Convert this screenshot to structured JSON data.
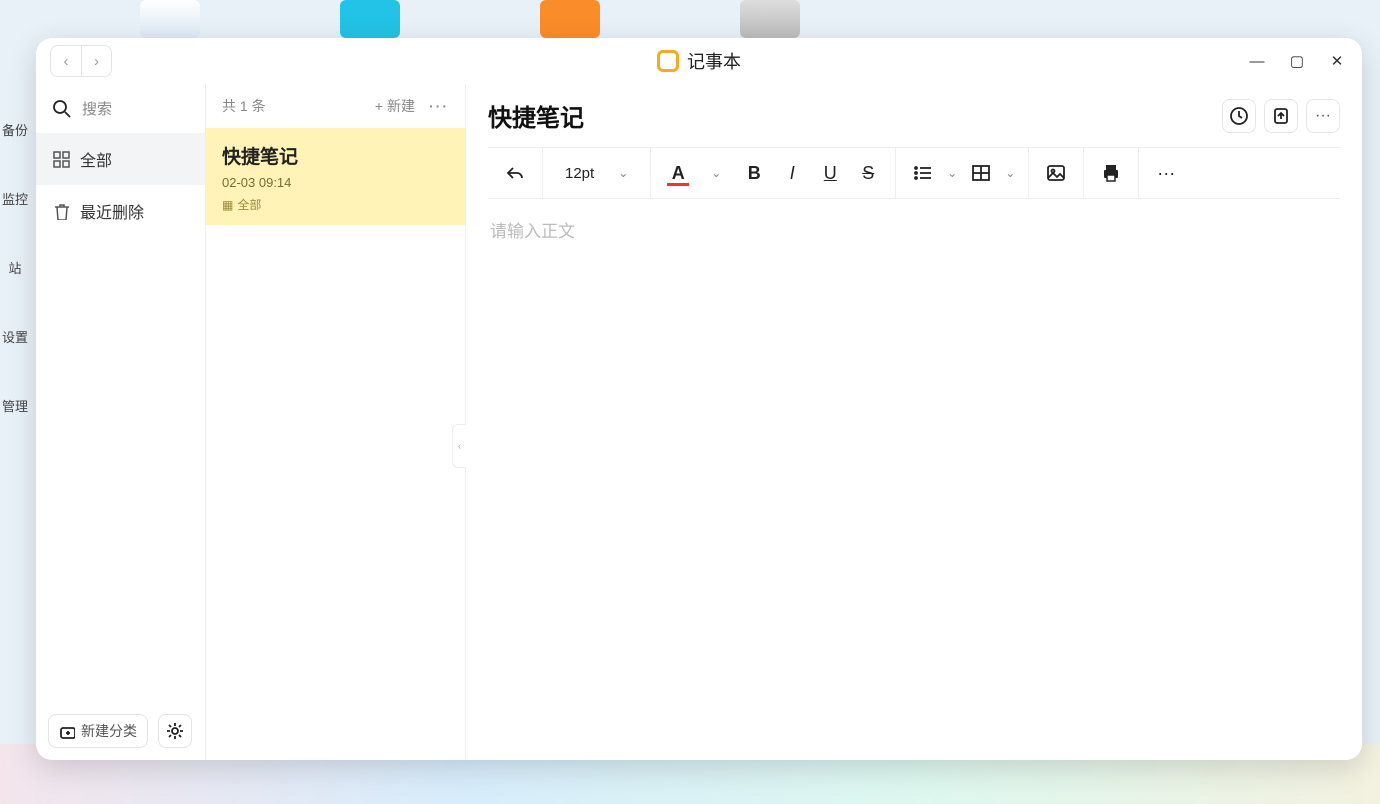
{
  "window": {
    "app_title": "记事本"
  },
  "dock": {
    "l1": "备份",
    "l2": "监控",
    "l3": "站",
    "l4": "设置",
    "l5": "管理"
  },
  "sidebar": {
    "search_placeholder": "搜索",
    "items": [
      {
        "label": "全部"
      },
      {
        "label": "最近删除"
      }
    ],
    "new_category": "新建分类"
  },
  "list": {
    "count_label": "共 1 条",
    "new_label": "新建",
    "notes": [
      {
        "title": "快捷笔记",
        "date": "02-03 09:14",
        "tag": "全部"
      }
    ]
  },
  "editor": {
    "title": "快捷笔记",
    "font_size": "12pt",
    "placeholder": "请输入正文"
  }
}
